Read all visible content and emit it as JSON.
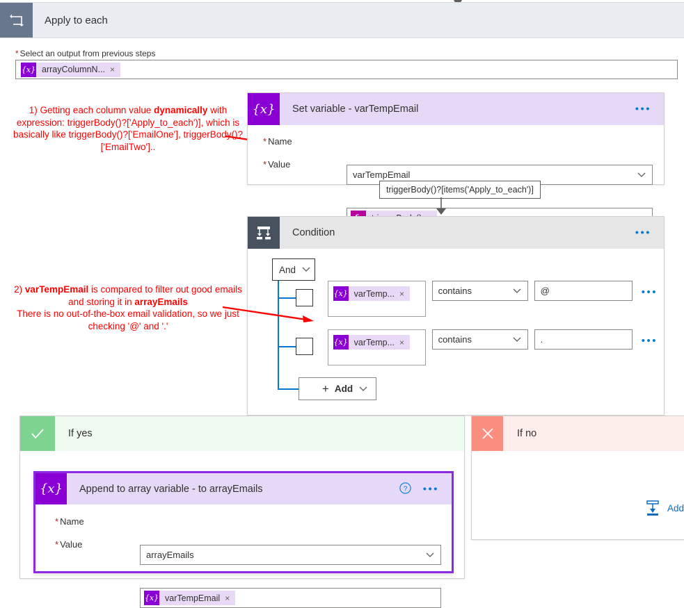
{
  "loop": {
    "title": "Apply to each",
    "icon": "loop-icon",
    "select_output_label": "Select an output from previous steps",
    "required_marker": "*",
    "output_token": {
      "icon": "variable-icon",
      "glyph": "{x}",
      "label": "arrayColumnN...",
      "remove": "×"
    }
  },
  "set_variable": {
    "title": "Set variable - varTempEmail",
    "icon": "variable-icon",
    "glyph": "{x}",
    "more_menu": "•••",
    "fields": {
      "name_label": "Name",
      "name_value": "varTempEmail",
      "value_label": "Value",
      "value_token": {
        "icon": "function-icon",
        "glyph": "fx",
        "label": "triggerBody()",
        "remove": "×"
      }
    },
    "tooltip": "triggerBody()?[items('Apply_to_each')]"
  },
  "condition": {
    "title": "Condition",
    "icon": "condition-icon",
    "more_menu": "•••",
    "logic_operator": "And",
    "rows": [
      {
        "operand_token": {
          "icon": "variable-icon",
          "glyph": "{x}",
          "label": "varTemp...",
          "remove": "×"
        },
        "operator": "contains",
        "value": "@",
        "more_menu": "•••"
      },
      {
        "operand_token": {
          "icon": "variable-icon",
          "glyph": "{x}",
          "label": "varTemp...",
          "remove": "×"
        },
        "operator": "contains",
        "value": ".",
        "more_menu": "•••"
      }
    ],
    "add_button": "Add",
    "add_plus": "+"
  },
  "if_yes": {
    "title": "If yes",
    "icon": "checkmark-icon"
  },
  "if_no": {
    "title": "If no",
    "icon": "close-icon",
    "add_action_link": "Add a",
    "add_action_icon": "add-action-icon"
  },
  "append_action": {
    "title": "Append to array variable - to arrayEmails",
    "icon": "variable-icon",
    "glyph": "{x}",
    "help": "?",
    "more_menu": "•••",
    "fields": {
      "name_label": "Name",
      "name_value": "arrayEmails",
      "value_label": "Value",
      "value_token": {
        "icon": "variable-icon",
        "glyph": "{x}",
        "label": "varTempEmail",
        "remove": "×"
      }
    }
  },
  "annotations": {
    "note1": {
      "prefix": "1) Getting each column value ",
      "bold1": "dynamically",
      "rest": " with expression: triggerBody()?['Apply_to_each')], which is basically like triggerBody()?['EmailOne'], triggerBody()?['EmailTwo'].."
    },
    "note2": {
      "prefix": "2) ",
      "bold1": "varTempEmail",
      "mid": " is compared to filter out good emails and storing it in ",
      "bold2": "arrayEmails",
      "rest": "There is no out-of-the-box email validation, so we just checking '@' and '.'"
    }
  },
  "colors": {
    "purple": "#8a00d4",
    "magenta": "#b4009e",
    "token_bg": "#e8d9f7",
    "loop_header": "#68778d",
    "condition_header": "#47525e",
    "yes_green": "#7ed391",
    "no_red": "#f98e7e",
    "link_blue": "#0078d4",
    "annotation_red": "#ff0000",
    "selected_border": "#8a2be2"
  }
}
